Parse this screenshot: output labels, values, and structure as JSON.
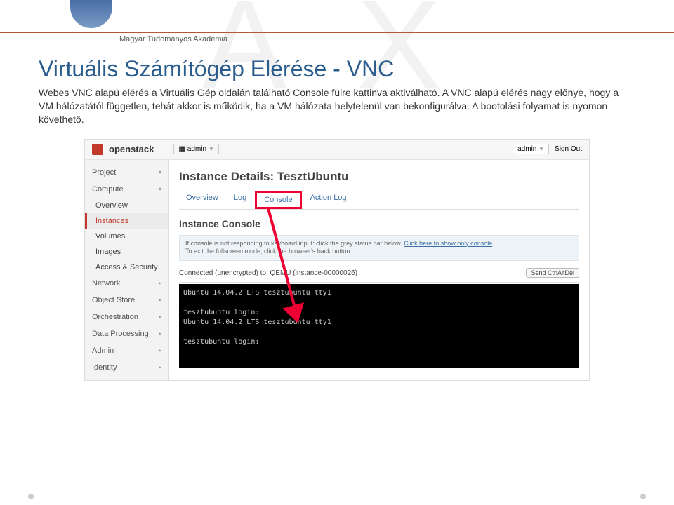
{
  "header": {
    "bg_letters": "A X",
    "org_label": "Magyar Tudományos Akadémia"
  },
  "page": {
    "title": "Virtuális Számítógép Elérése - VNC",
    "paragraph": "Webes VNC alapú elérés a Virtuális Gép oldalán található Console fülre kattinva aktiválható. A VNC alapú elérés nagy előnye, hogy a VM hálózatától független, tehát akkor is működik, ha a VM hálózata helytelenül van bekonfigurálva. A bootolási folyamat is nyomon követhető."
  },
  "openstack": {
    "brand": "openstack",
    "domain_label": "admin",
    "user_label": "admin",
    "sign_out": "Sign Out",
    "sidebar": {
      "project": "Project",
      "compute": "Compute",
      "items": [
        "Overview",
        "Instances",
        "Volumes",
        "Images",
        "Access & Security"
      ],
      "network": "Network",
      "object_store": "Object Store",
      "orchestration": "Orchestration",
      "data_processing": "Data Processing",
      "admin": "Admin",
      "identity": "Identity"
    },
    "main": {
      "title": "Instance Details: TesztUbuntu",
      "tabs": [
        "Overview",
        "Log",
        "Console",
        "Action Log"
      ],
      "panel_title": "Instance Console",
      "hint_line1": "If console is not responding to keyboard input: click the grey status bar below. ",
      "hint_link": "Click here to show only console",
      "hint_line2": "To exit the fullscreen mode, click the browser's back button.",
      "connected": "Connected (unencrypted) to: QEMU (instance-00000026)",
      "send_cad": "Send CtrlAltDel",
      "terminal_lines": [
        "Ubuntu 14.04.2 LTS tesztubuntu tty1",
        "",
        "tesztubuntu login:",
        "Ubuntu 14.04.2 LTS tesztubuntu tty1",
        "",
        "tesztubuntu login:"
      ]
    }
  }
}
